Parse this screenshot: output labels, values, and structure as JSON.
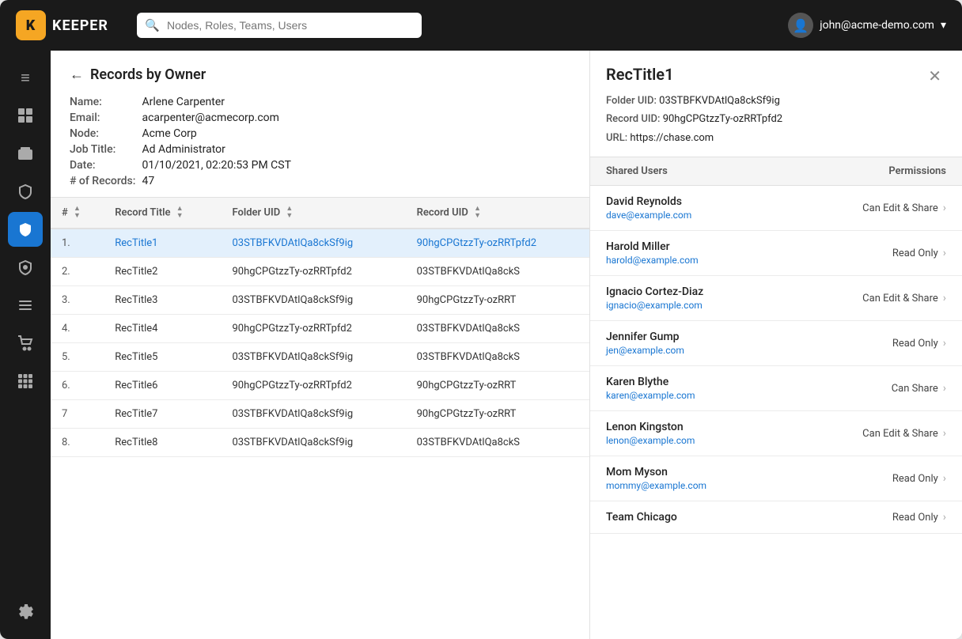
{
  "app": {
    "title": "KEEPER",
    "logo_letter": "K"
  },
  "topnav": {
    "search_placeholder": "Nodes, Roles, Teams, Users",
    "user_email": "john@acme-demo.com",
    "dropdown_icon": "▾"
  },
  "sidebar": {
    "items": [
      {
        "id": "menu",
        "icon": "≡",
        "label": "menu-icon",
        "active": false
      },
      {
        "id": "dashboard",
        "icon": "⊞",
        "label": "dashboard-icon",
        "active": false
      },
      {
        "id": "vault",
        "icon": "⬛",
        "label": "vault-icon",
        "active": false
      },
      {
        "id": "shield",
        "icon": "🛡",
        "label": "security-icon",
        "active": false
      },
      {
        "id": "active-shield",
        "icon": "✔",
        "label": "active-shield-icon",
        "active": true
      },
      {
        "id": "key-shield",
        "icon": "🔑",
        "label": "key-icon",
        "active": false
      },
      {
        "id": "list",
        "icon": "≡",
        "label": "list-icon",
        "active": false
      },
      {
        "id": "cart",
        "icon": "🛒",
        "label": "shop-icon",
        "active": false
      },
      {
        "id": "grid",
        "icon": "⠿",
        "label": "grid-icon",
        "active": false
      },
      {
        "id": "settings",
        "icon": "⚙",
        "label": "settings-icon",
        "active": false
      }
    ]
  },
  "left_panel": {
    "back_label": "Records by Owner",
    "meta": {
      "name_label": "Name:",
      "name_value": "Arlene Carpenter",
      "email_label": "Email:",
      "email_value": "acarpenter@acmecorp.com",
      "node_label": "Node:",
      "node_value": "Acme Corp",
      "job_title_label": "Job Title:",
      "job_title_value": "Ad Administrator",
      "date_label": "Date:",
      "date_value": "01/10/2021, 02:20:53 PM CST",
      "records_label": "# of Records:",
      "records_value": "47"
    },
    "table": {
      "columns": [
        {
          "id": "num",
          "label": "#",
          "sortable": true
        },
        {
          "id": "record_title",
          "label": "Record Title",
          "sortable": true
        },
        {
          "id": "folder_uid",
          "label": "Folder UID",
          "sortable": true
        },
        {
          "id": "record_uid",
          "label": "Record UID",
          "sortable": true
        }
      ],
      "rows": [
        {
          "num": "1.",
          "record_title": "RecTitle1",
          "folder_uid": "03STBFKVDAtlQa8ckSf9ig",
          "record_uid": "90hgCPGtzzTy-ozRRTpfd2",
          "link": true,
          "selected": true
        },
        {
          "num": "2.",
          "record_title": "RecTitle2",
          "folder_uid": "90hgCPGtzzTy-ozRRTpfd2",
          "record_uid": "03STBFKVDAtlQa8ckS",
          "link": false,
          "selected": false
        },
        {
          "num": "3.",
          "record_title": "RecTitle3",
          "folder_uid": "03STBFKVDAtlQa8ckSf9ig",
          "record_uid": "90hgCPGtzzTy-ozRRT",
          "link": false,
          "selected": false
        },
        {
          "num": "4.",
          "record_title": "RecTitle4",
          "folder_uid": "90hgCPGtzzTy-ozRRTpfd2",
          "record_uid": "03STBFKVDAtlQa8ckS",
          "link": false,
          "selected": false
        },
        {
          "num": "5.",
          "record_title": "RecTitle5",
          "folder_uid": "03STBFKVDAtlQa8ckSf9ig",
          "record_uid": "03STBFKVDAtlQa8ckS",
          "link": false,
          "selected": false
        },
        {
          "num": "6.",
          "record_title": "RecTitle6",
          "folder_uid": "90hgCPGtzzTy-ozRRTpfd2",
          "record_uid": "90hgCPGtzzTy-ozRRT",
          "link": false,
          "selected": false
        },
        {
          "num": "7",
          "record_title": "RecTitle7",
          "folder_uid": "03STBFKVDAtlQa8ckSf9ig",
          "record_uid": "90hgCPGtzzTy-ozRRT",
          "link": false,
          "selected": false
        },
        {
          "num": "8.",
          "record_title": "RecTitle8",
          "folder_uid": "03STBFKVDAtlQa8ckSf9ig",
          "record_uid": "03STBFKVDAtlQa8ckS",
          "link": false,
          "selected": false
        }
      ]
    }
  },
  "right_panel": {
    "record_title": "RecTitle1",
    "folder_uid_label": "Folder UID:",
    "folder_uid_value": "03STBFKVDAtlQa8ckSf9ig",
    "record_uid_label": "Record UID:",
    "record_uid_value": "90hgCPGtzzTy-ozRRTpfd2",
    "url_label": "URL:",
    "url_value": "https://chase.com",
    "shared_users_col": "Shared Users",
    "permissions_col": "Permissions",
    "shared_users": [
      {
        "name": "David Reynolds",
        "email": "dave@example.com",
        "permission": "Can Edit & Share"
      },
      {
        "name": "Harold Miller",
        "email": "harold@example.com",
        "permission": "Read Only"
      },
      {
        "name": "Ignacio Cortez-Diaz",
        "email": "ignacio@example.com",
        "permission": "Can Edit & Share"
      },
      {
        "name": "Jennifer Gump",
        "email": "jen@example.com",
        "permission": "Read Only"
      },
      {
        "name": "Karen Blythe",
        "email": "karen@example.com",
        "permission": "Can Share"
      },
      {
        "name": "Lenon Kingston",
        "email": "lenon@example.com",
        "permission": "Can Edit & Share"
      },
      {
        "name": "Mom Myson",
        "email": "mommy@example.com",
        "permission": "Read Only"
      },
      {
        "name": "Team Chicago",
        "email": "",
        "permission": "Read Only"
      }
    ]
  }
}
